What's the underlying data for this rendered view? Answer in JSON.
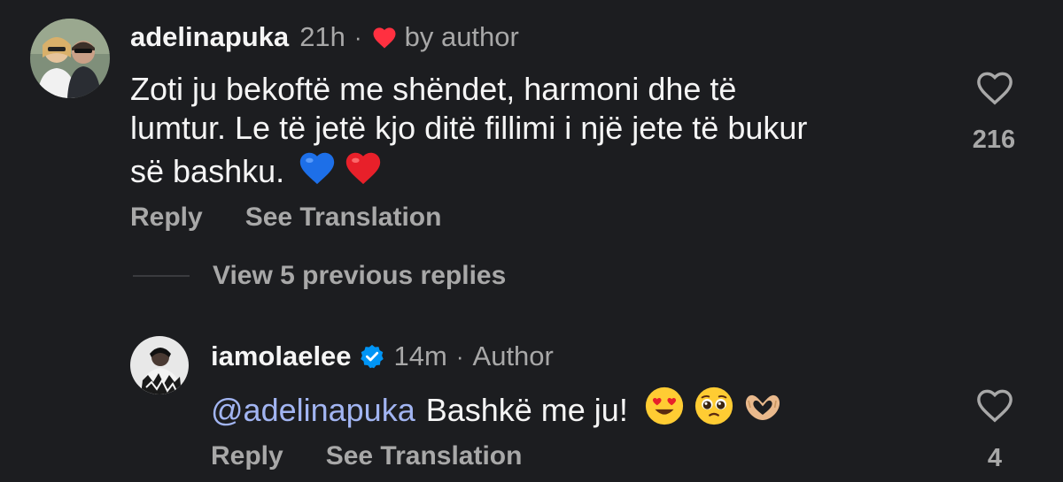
{
  "comment": {
    "username": "adelinapuka",
    "time": "21h",
    "separator": "·",
    "liked_by": "by author",
    "text_line1": "Zoti ju bekoftë me shëndet, harmoni dhe të",
    "text_line2": "lumtur. Le të jetë kjo ditë fillimi i një jete të bukur",
    "text_line3": "së bashku.",
    "reply_label": "Reply",
    "translate_label": "See Translation",
    "like_count": "216"
  },
  "view_replies": {
    "label": "View 5 previous replies"
  },
  "reply": {
    "username": "iamolaelee",
    "time": "14m",
    "separator": "·",
    "author_badge": "Author",
    "mention": "@adelinapuka",
    "text": "Bashkë me ju!",
    "reply_label": "Reply",
    "translate_label": "See Translation",
    "like_count": "4"
  },
  "colors": {
    "background": "#1c1d20",
    "primary_text": "#f5f5f5",
    "secondary_text": "#a8a8a8",
    "mention": "#a2b5f2",
    "heart_red": "#ff3040",
    "verified_blue": "#0095f6"
  },
  "icons": [
    "heart-filled-icon",
    "heart-outline-icon",
    "verified-badge-icon",
    "blue-heart-emoji",
    "red-heart-emoji",
    "heart-eyes-emoji",
    "pleading-face-emoji",
    "heart-hands-emoji"
  ]
}
